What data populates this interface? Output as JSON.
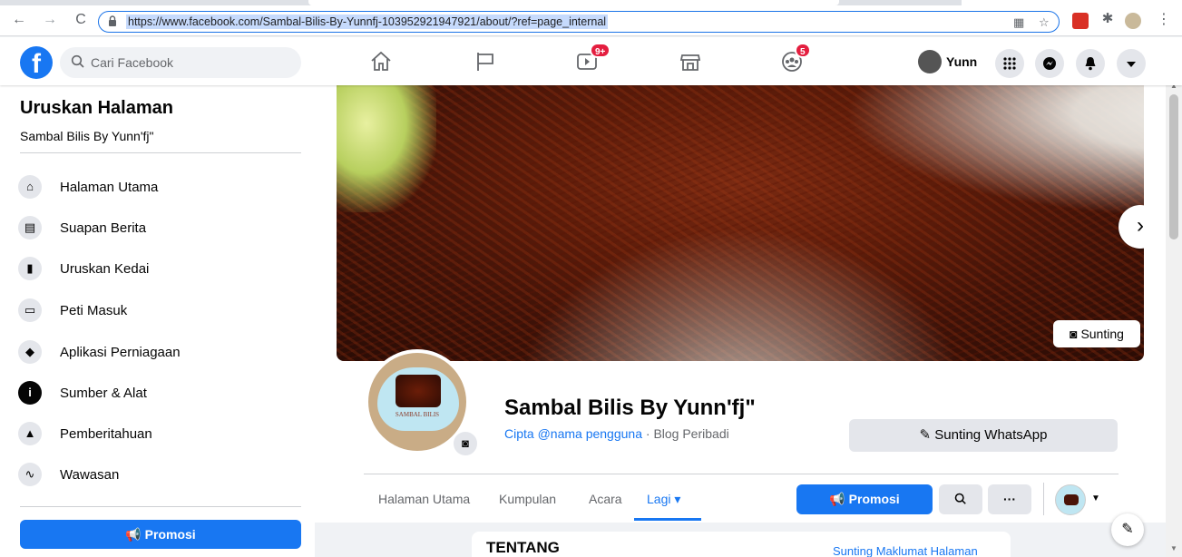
{
  "browser": {
    "url": "https://www.facebook.com/Sambal-Bilis-By-Yunnfj-103952921947921/about/?ref=page_internal",
    "back": "←",
    "forward": "→",
    "reload": "C",
    "menu": "⋮"
  },
  "fb": {
    "logo": "f",
    "search_placeholder": "Cari Facebook",
    "watch_badge": "9+",
    "groups_badge": "5",
    "user_name": "Yunn"
  },
  "sidebar": {
    "title": "Uruskan Halaman",
    "subtitle": "Sambal Bilis By Yunn'fj\"",
    "items": [
      {
        "label": "Halaman Utama",
        "icon": "home-icon"
      },
      {
        "label": "Suapan Berita",
        "icon": "news-feed-icon"
      },
      {
        "label": "Uruskan Kedai",
        "icon": "shop-bag-icon"
      },
      {
        "label": "Peti Masuk",
        "icon": "inbox-icon"
      },
      {
        "label": "Aplikasi Perniagaan",
        "icon": "business-apps-icon"
      },
      {
        "label": "Sumber & Alat",
        "icon": "info-icon"
      },
      {
        "label": "Pemberitahuan",
        "icon": "bell-icon"
      },
      {
        "label": "Wawasan",
        "icon": "insights-icon"
      }
    ],
    "promo_label": "Promosi"
  },
  "page": {
    "cover_edit_label": "Sunting",
    "avatar_text": "SAMBAL BILIS",
    "name": "Sambal Bilis By Yunn'fj\"",
    "create_username": "Cipta @nama pengguna",
    "separator": " · ",
    "category": "Blog Peribadi",
    "whatsapp_label": "Sunting WhatsApp",
    "tabs": [
      "Halaman Utama",
      "Kumpulan",
      "Acara",
      "Lagi"
    ],
    "active_tab": "Lagi",
    "promo_label": "Promosi",
    "more_label": "···",
    "about_title": "TENTANG",
    "about_edit_link": "Sunting Maklumat Halaman"
  },
  "colors": {
    "accent": "#1877f2",
    "badge": "#e41e3f"
  }
}
